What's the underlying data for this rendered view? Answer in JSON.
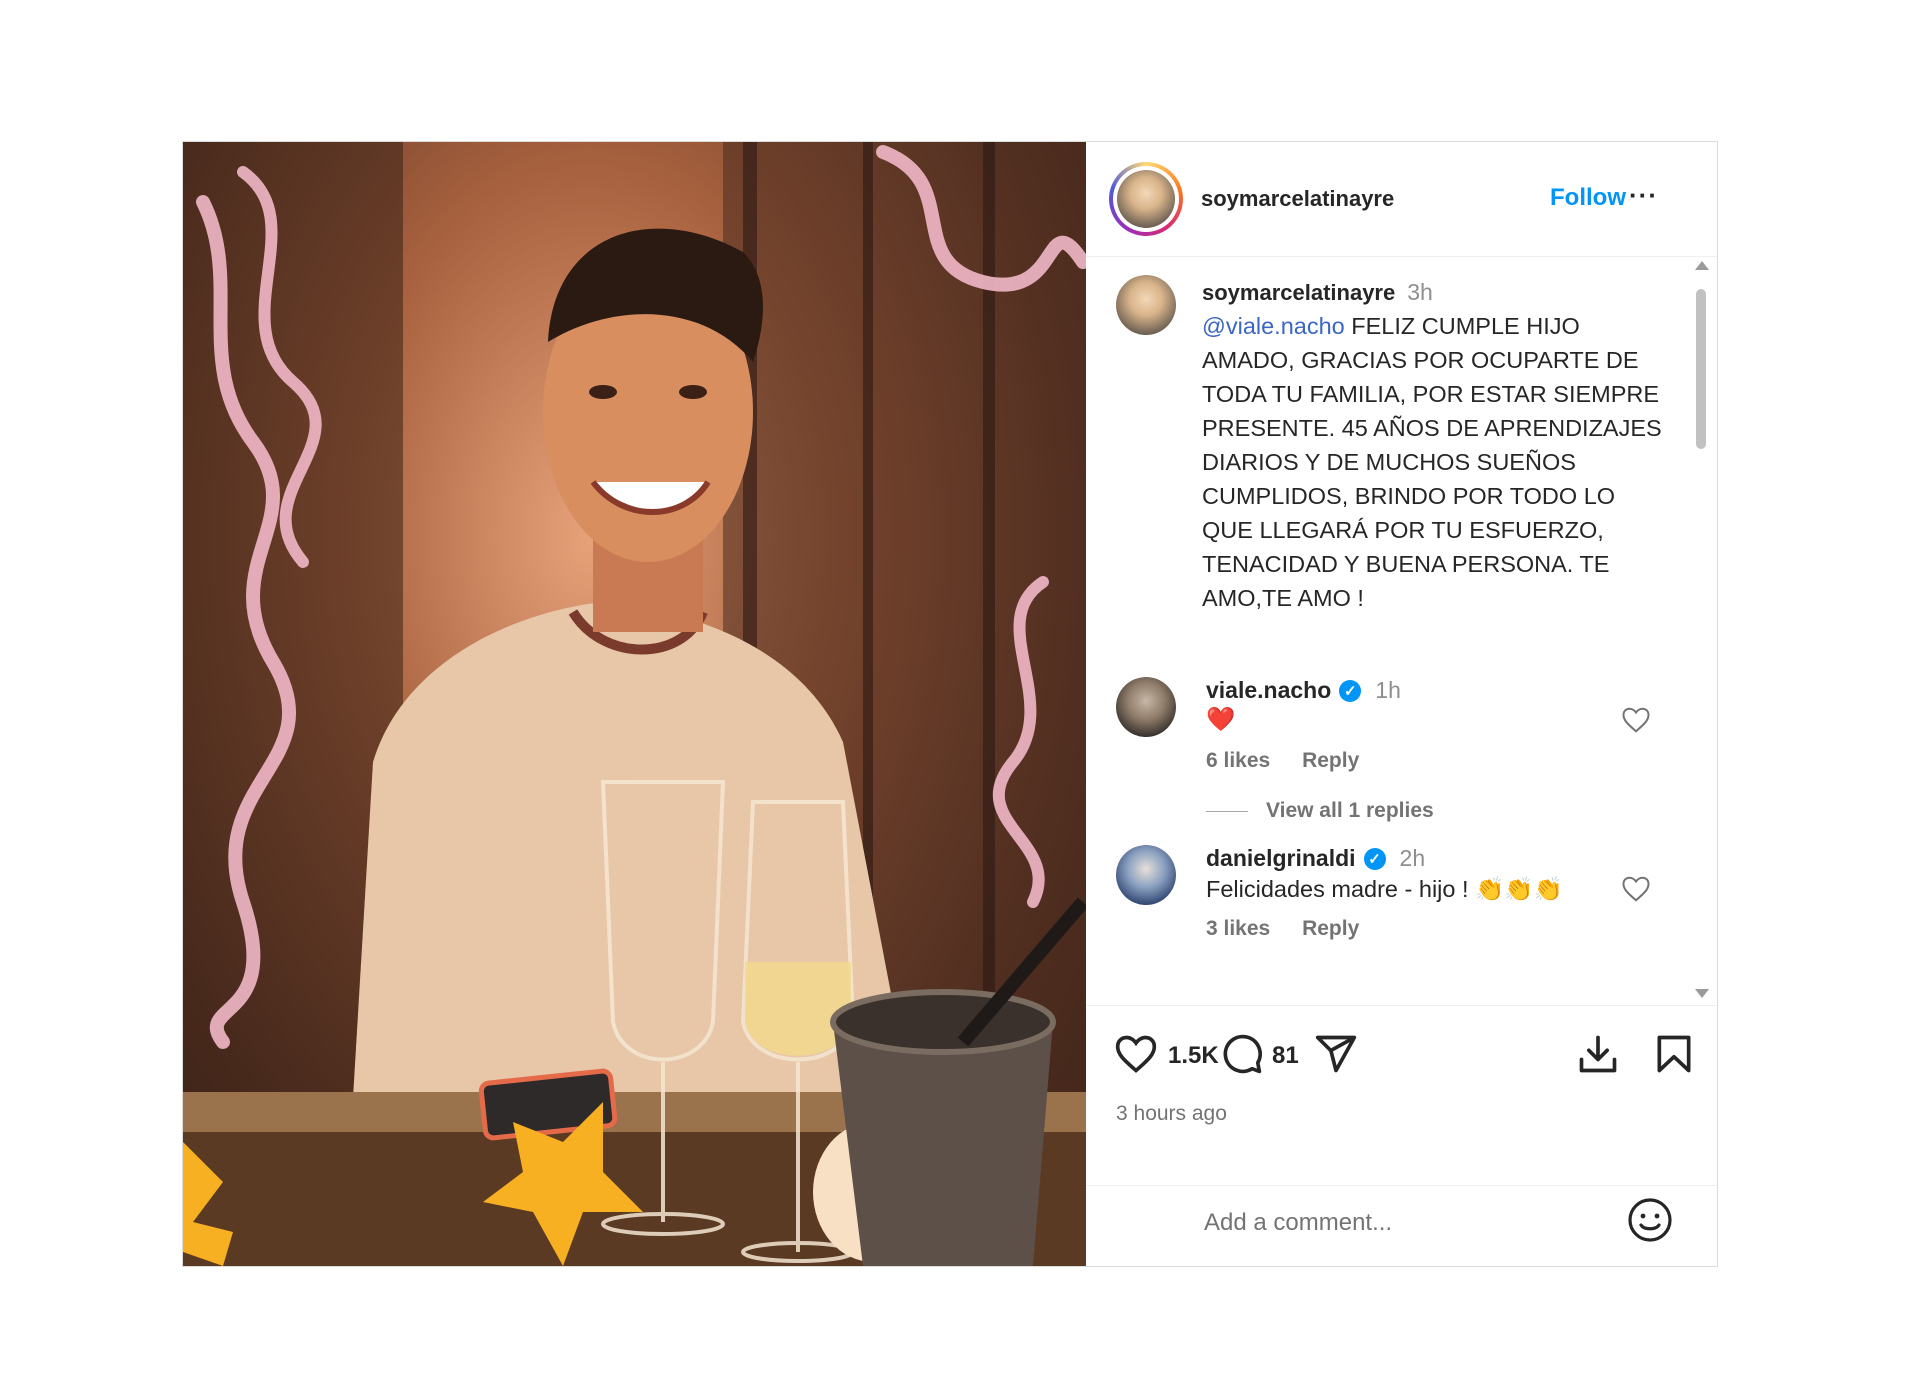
{
  "post": {
    "username": "soymarcelatinayre",
    "follow_label": "Follow",
    "more_label": "···"
  },
  "caption": {
    "username": "soymarcelatinayre",
    "time": "3h",
    "mention": "@viale.nacho",
    "text": " FELIZ CUMPLE HIJO AMADO, GRACIAS POR OCUPARTE DE TODA TU FAMILIA, POR ESTAR SIEMPRE PRESENTE. 45 AÑOS DE APRENDIZAJES DIARIOS Y DE MUCHOS SUEÑOS CUMPLIDOS, BRINDO POR TODO LO QUE LLEGARÁ POR TU ESFUERZO, TENACIDAD Y BUENA PERSONA. TE AMO,TE AMO !"
  },
  "comments": [
    {
      "username": "viale.nacho",
      "verified": true,
      "time": "1h",
      "text": "❤️",
      "likes": "6 likes",
      "reply": "Reply",
      "view_replies": "View all 1 replies"
    },
    {
      "username": "danielgrinaldi",
      "verified": true,
      "time": "2h",
      "text": "Felicidades madre - hijo ! 👏👏👏",
      "likes": "3 likes",
      "reply": "Reply"
    }
  ],
  "actions": {
    "like_count": "1.5K",
    "comment_count": "81",
    "posted_ago": "3 hours ago"
  },
  "add_comment": {
    "placeholder": "Add a comment..."
  },
  "colors": {
    "accent": "#0095f6",
    "mention": "#3b66c4",
    "heart": "#ed4956"
  }
}
